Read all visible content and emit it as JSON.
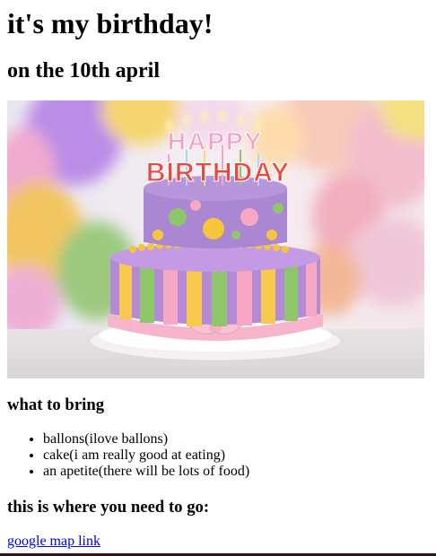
{
  "page": {
    "title": "it's my birthday!",
    "subtitle": "on the 10th april"
  },
  "hero_image": {
    "candle_text_top": "HAPPY",
    "candle_text_bottom": "BIRTHDAY"
  },
  "bring_section": {
    "heading": "what to bring",
    "items": [
      "ballons(ilove ballons)",
      "cake(i am really good at eating)",
      "an apetite(there will be lots of food)"
    ]
  },
  "location_section": {
    "heading": "this is where you need to go:",
    "link_text": "google map link"
  },
  "colors": {
    "link": "#0000ee",
    "bottom_edge": "#3a0d1a"
  }
}
